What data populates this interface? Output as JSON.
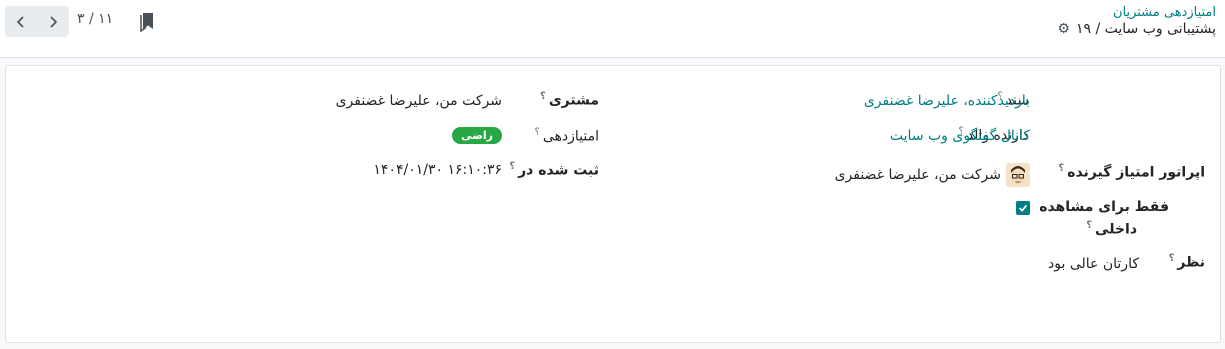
{
  "breadcrumb": {
    "parent": "امتیازدهی مشتریان",
    "current": "پشتیبانی وب سایت / ۱۹"
  },
  "pager": {
    "value": "۱۱ / ۳"
  },
  "form": {
    "left": {
      "customer": {
        "label": "مشتری",
        "value": "شرکت من، علیرضا غضنفری"
      },
      "rating": {
        "label": "امتیازدهی",
        "value": "راضی"
      },
      "submitted": {
        "label": "ثبت شده در",
        "value": "۱۴۰۴/۰۱/۳۰ ۱۶:۱۰:۳۶"
      }
    },
    "right": {
      "document": {
        "label": "سند",
        "value": "بازدیدکننده، علیرضا غضنفری"
      },
      "parent_holder": {
        "label": "دارنده والد",
        "value": "کانال گفتگوی وب سایت"
      },
      "rated_operator": {
        "label": "اپراتور امتیاز گیرنده",
        "value": "شرکت من، علیرضا غضنفری"
      },
      "internal_only": {
        "label_line1": "فقط برای مشاهده",
        "label_line2": "داخلی",
        "checked": true
      },
      "comment": {
        "label": "نظر",
        "value": "کارتان عالی بود"
      }
    }
  },
  "colors": {
    "accent": "#017e84",
    "badge": "#28a745"
  }
}
